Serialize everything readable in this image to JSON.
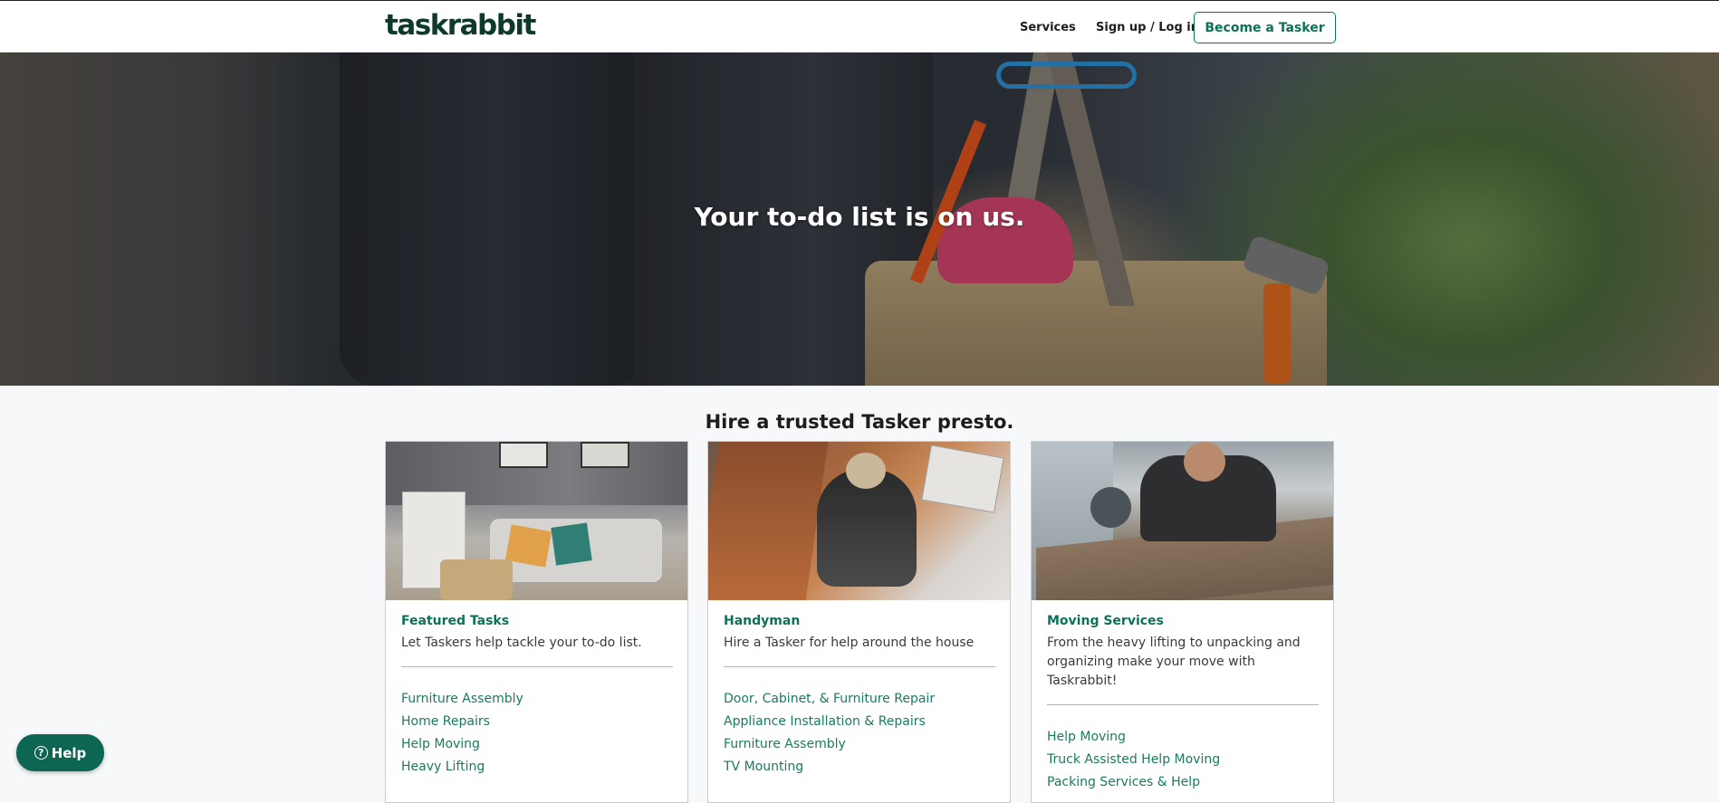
{
  "header": {
    "logo": "taskrabbit",
    "nav": {
      "services": "Services",
      "login": "Sign up / Log in",
      "become_tasker": "Become a Tasker"
    }
  },
  "hero": {
    "title": "Your to-do list is on us."
  },
  "section": {
    "title": "Hire a trusted Tasker presto."
  },
  "cards": [
    {
      "title": "Featured Tasks",
      "description": "Let Taskers help tackle your to-do list.",
      "links": [
        "Furniture Assembly",
        "Home Repairs",
        "Help Moving",
        "Heavy Lifting"
      ]
    },
    {
      "title": "Handyman",
      "description": "Hire a Tasker for help around the house",
      "links": [
        "Door, Cabinet, & Furniture Repair",
        "Appliance Installation & Repairs",
        "Furniture Assembly",
        "TV Mounting"
      ]
    },
    {
      "title": "Moving Services",
      "description": "From the heavy lifting to unpacking and organizing make your move with Taskrabbit!",
      "links": [
        "Help Moving",
        "Truck Assisted Help Moving",
        "Packing Services & Help"
      ]
    }
  ],
  "help": {
    "label": "Help",
    "icon": "question-circle-icon"
  },
  "colors": {
    "brand_green": "#0d7159",
    "help_button": "#0d6651",
    "logo": "#0d3a2c"
  }
}
